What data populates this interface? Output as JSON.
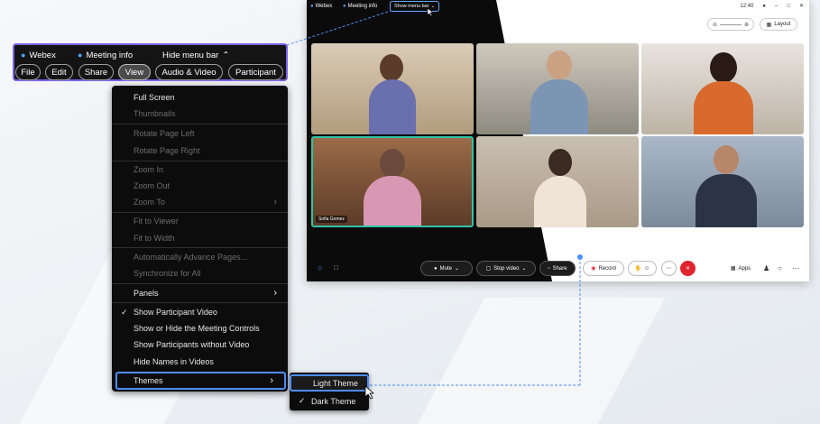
{
  "window": {
    "titlebar": {
      "app": "Webex",
      "meeting_info": "Meeting info",
      "menu_toggle": "Show menu bar",
      "time": "12:40"
    },
    "layout_label": "Layout",
    "participants": [
      {
        "name": ""
      },
      {
        "name": ""
      },
      {
        "name": ""
      },
      {
        "name": "Sofia Gomez"
      },
      {
        "name": ""
      },
      {
        "name": ""
      }
    ],
    "controls": {
      "mute": "Mute",
      "stop_video": "Stop video",
      "share": "Share",
      "record": "Record",
      "apps": "Apps"
    }
  },
  "menubar": {
    "app": "Webex",
    "meeting_info": "Meeting info",
    "hide_label": "Hide menu bar",
    "menus": [
      "File",
      "Edit",
      "Share",
      "View",
      "Audio & Video",
      "Participant"
    ]
  },
  "view_menu": {
    "items": [
      {
        "label": "Full Screen",
        "enabled": true
      },
      {
        "label": "Thumbnails",
        "enabled": false
      },
      {
        "label": "Rotate Page Left",
        "enabled": false
      },
      {
        "label": "Rotate Page Right",
        "enabled": false
      },
      {
        "label": "Zoom In",
        "enabled": false
      },
      {
        "label": "Zoom Out",
        "enabled": false
      },
      {
        "label": "Zoom To",
        "enabled": false
      },
      {
        "label": "Fit to Viewer",
        "enabled": false
      },
      {
        "label": "Fit to Width",
        "enabled": false
      },
      {
        "label": "Automatically Advance Pages...",
        "enabled": false
      },
      {
        "label": "Synchronize for All",
        "enabled": false
      },
      {
        "label": "Panels",
        "enabled": true
      },
      {
        "label": "Show Participant Video",
        "enabled": true,
        "checked": true
      },
      {
        "label": "Show or Hide the Meeting Controls",
        "enabled": true
      },
      {
        "label": "Show Participants without Video",
        "enabled": true
      },
      {
        "label": "Hide Names in Videos",
        "enabled": true
      },
      {
        "label": "Themes",
        "enabled": true
      }
    ]
  },
  "themes_menu": {
    "items": [
      {
        "label": "Light Theme"
      },
      {
        "label": "Dark Theme",
        "checked": true
      }
    ]
  },
  "colors": {
    "accent_blue": "#4d8df7",
    "accent_purple": "#7b62e8",
    "active_speaker": "#2ec4a6",
    "leave_red": "#e0242f"
  }
}
